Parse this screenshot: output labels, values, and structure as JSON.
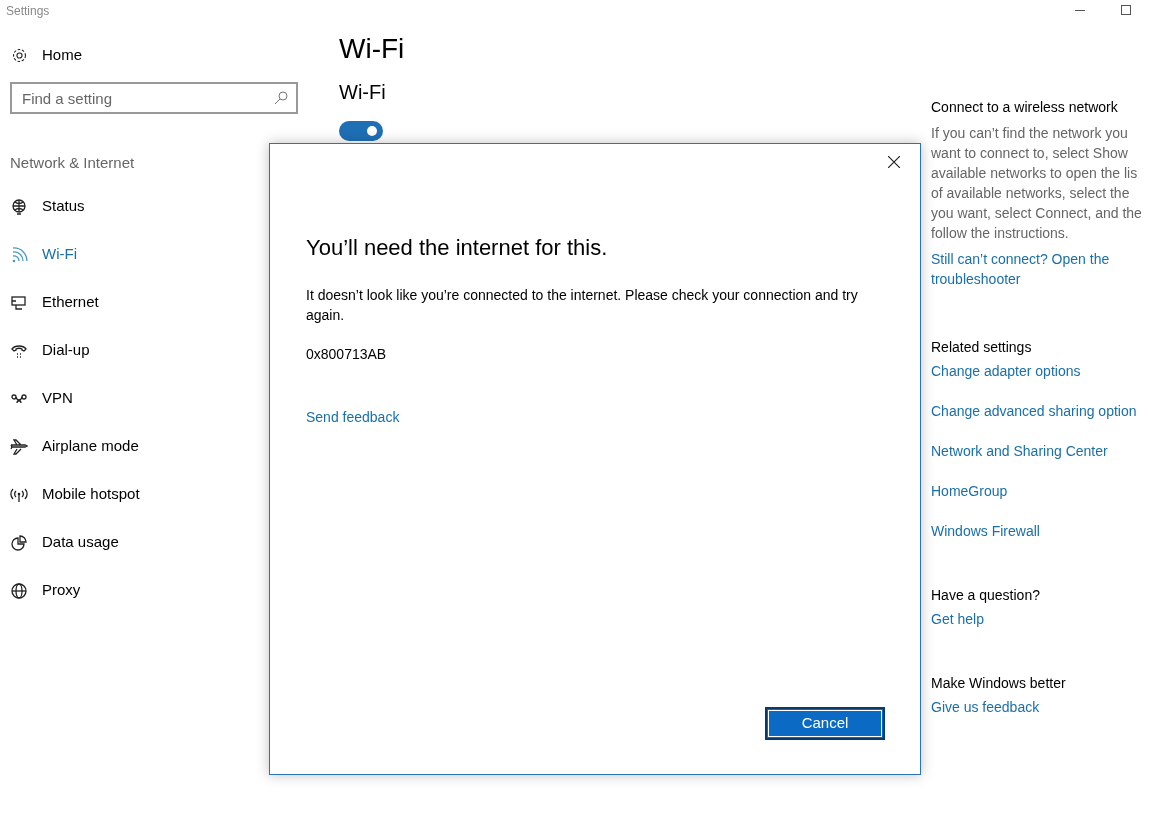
{
  "window": {
    "title": "Settings"
  },
  "sidebar": {
    "home": "Home",
    "search": {
      "placeholder": "Find a setting"
    },
    "section": "Network & Internet",
    "items": [
      {
        "kind": "status",
        "label": "Status",
        "selected": false
      },
      {
        "kind": "wifi",
        "label": "Wi-Fi",
        "selected": true
      },
      {
        "kind": "ethernet",
        "label": "Ethernet",
        "selected": false
      },
      {
        "kind": "dialup",
        "label": "Dial-up",
        "selected": false
      },
      {
        "kind": "vpn",
        "label": "VPN",
        "selected": false
      },
      {
        "kind": "airplane",
        "label": "Airplane mode",
        "selected": false
      },
      {
        "kind": "hotspot",
        "label": "Mobile hotspot",
        "selected": false
      },
      {
        "kind": "data",
        "label": "Data usage",
        "selected": false
      },
      {
        "kind": "proxy",
        "label": "Proxy",
        "selected": false
      }
    ]
  },
  "main": {
    "title": "Wi-Fi",
    "section": "Wi-Fi",
    "toggle": {
      "on": true
    }
  },
  "aside": [
    {
      "heading": "Connect to a wireless network",
      "text": "If you can’t find the network you\nwant to connect to, select Show\navailable networks to open the lis\nof available networks, select the\nyou want, select Connect, and the\nfollow the instructions.",
      "links": [
        "Still can’t connect? Open the troubleshooter"
      ]
    },
    {
      "heading": "Related settings",
      "links": [
        "Change adapter options",
        "Change advanced sharing option",
        "Network and Sharing Center",
        "HomeGroup",
        "Windows Firewall"
      ]
    },
    {
      "heading": "Have a question?",
      "links": [
        "Get help"
      ]
    },
    {
      "heading": "Make Windows better",
      "links": [
        "Give us feedback"
      ]
    }
  ],
  "dialog": {
    "title": "You’ll need the internet for this.",
    "message": "It doesn’t look like you’re connected to the internet. Please check your connection and try again.",
    "code": "0x800713AB",
    "link": "Send feedback",
    "button": "Cancel"
  }
}
